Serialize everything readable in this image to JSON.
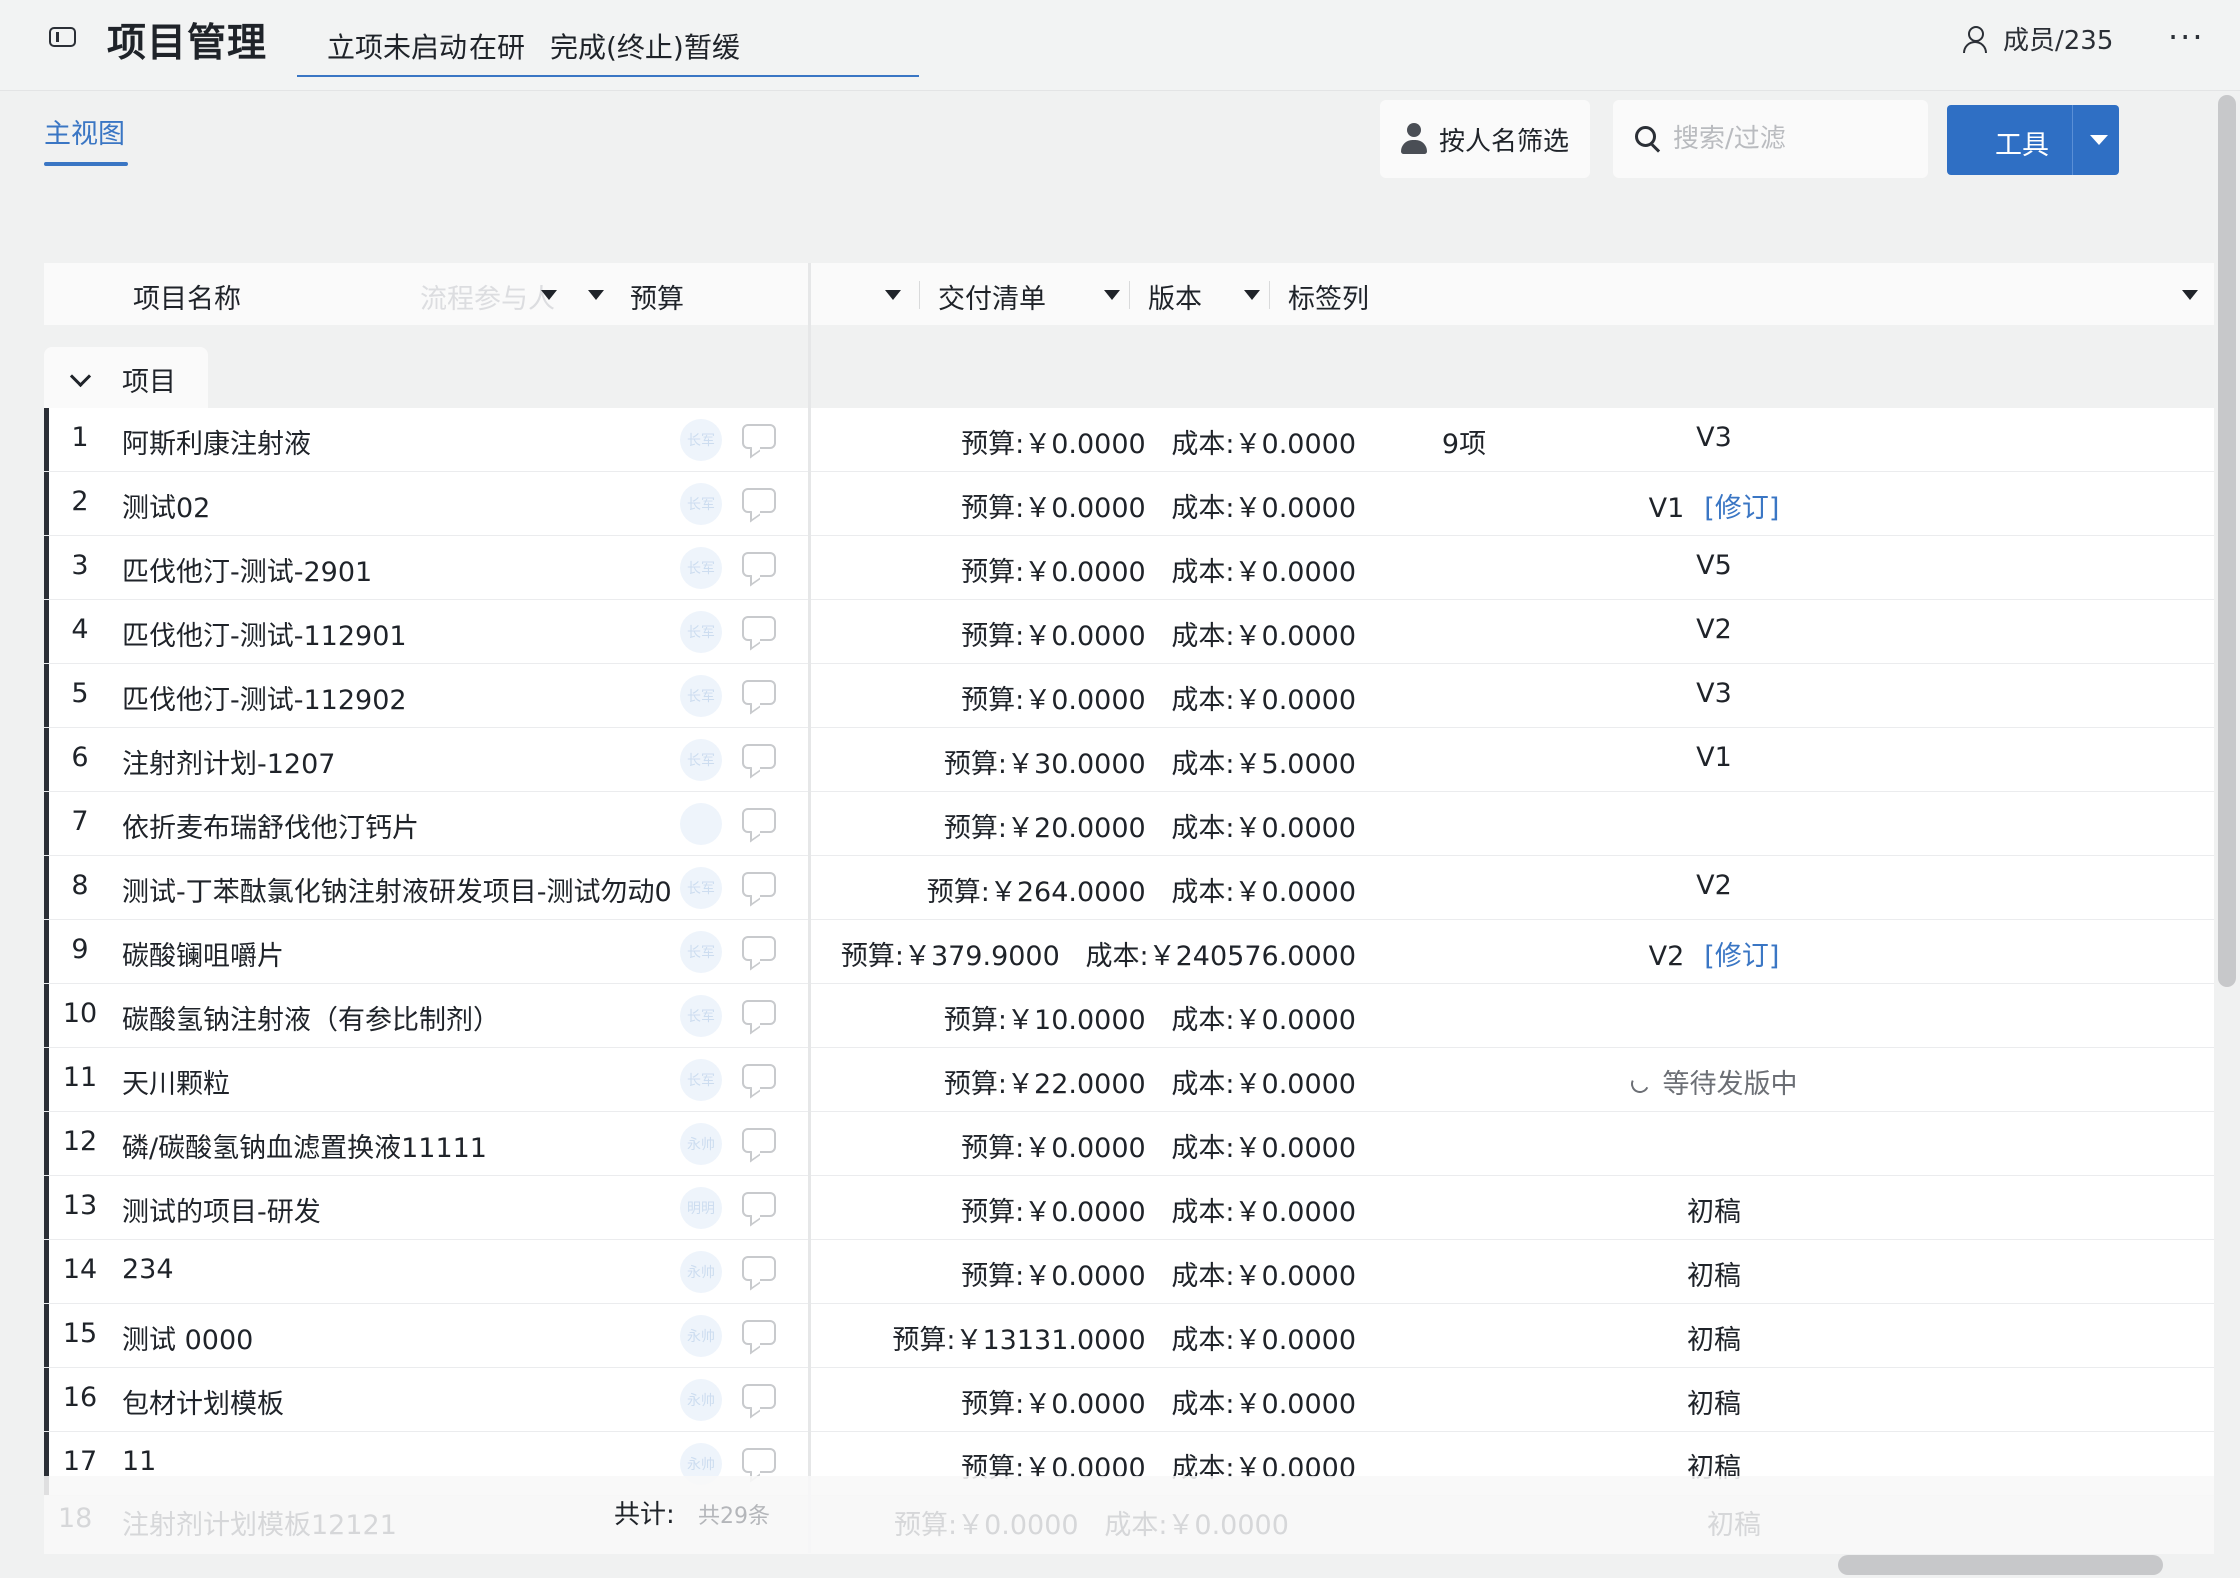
{
  "app": {
    "title": "项目管理"
  },
  "tabs": [
    "立项未启动",
    "在研",
    "完成(终止)",
    "暂缓"
  ],
  "members": {
    "label": "成员/235"
  },
  "more_label": "···",
  "view": {
    "tab": "主视图"
  },
  "toolbar": {
    "filter_by_person": "按人名筛选",
    "search_placeholder": "搜索/过滤",
    "tools_label": "工具"
  },
  "columns": {
    "name": "项目名称",
    "participants": "流程参与人",
    "budget": "预算",
    "delivery": "交付清单",
    "version": "版本",
    "tags": "标签列"
  },
  "group": {
    "label": "项目"
  },
  "rows": [
    {
      "num": "1",
      "name": "阿斯利康注射液",
      "avatar": "长军",
      "budget": "预算:￥0.0000   成本:￥0.0000",
      "delivery": "9项",
      "version": "V3",
      "revise": ""
    },
    {
      "num": "2",
      "name": "测试02",
      "avatar": "长军",
      "budget": "预算:￥0.0000   成本:￥0.0000",
      "delivery": "",
      "version": "V1",
      "revise": "[修订]"
    },
    {
      "num": "3",
      "name": "匹伐他汀-测试-2901",
      "avatar": "长军",
      "budget": "预算:￥0.0000   成本:￥0.0000",
      "delivery": "",
      "version": "V5",
      "revise": ""
    },
    {
      "num": "4",
      "name": "匹伐他汀-测试-112901",
      "avatar": "长军",
      "budget": "预算:￥0.0000   成本:￥0.0000",
      "delivery": "",
      "version": "V2",
      "revise": ""
    },
    {
      "num": "5",
      "name": "匹伐他汀-测试-112902",
      "avatar": "长军",
      "budget": "预算:￥0.0000   成本:￥0.0000",
      "delivery": "",
      "version": "V3",
      "revise": ""
    },
    {
      "num": "6",
      "name": "注射剂计划-1207",
      "avatar": "长军",
      "budget": "预算:￥30.0000   成本:￥5.0000",
      "delivery": "",
      "version": "V1",
      "revise": ""
    },
    {
      "num": "7",
      "name": "依折麦布瑞舒伐他汀钙片",
      "avatar": "",
      "budget": "预算:￥20.0000   成本:￥0.0000",
      "delivery": "",
      "version": "",
      "revise": ""
    },
    {
      "num": "8",
      "name": "测试-丁苯酞氯化钠注射液研发项目-测试勿动0",
      "avatar": "长军",
      "budget": "预算:￥264.0000   成本:￥0.0000",
      "delivery": "",
      "version": "V2",
      "revise": ""
    },
    {
      "num": "9",
      "name": "碳酸镧咀嚼片",
      "avatar": "长军",
      "budget": "预算:￥379.9000   成本:￥240576.0000",
      "delivery": "",
      "version": "V2",
      "revise": "[修订]"
    },
    {
      "num": "10",
      "name": "碳酸氢钠注射液（有参比制剂）",
      "avatar": "长军",
      "budget": "预算:￥10.0000   成本:￥0.0000",
      "delivery": "",
      "version": "",
      "revise": ""
    },
    {
      "num": "11",
      "name": "天川颗粒",
      "avatar": "长军",
      "budget": "预算:￥22.0000   成本:￥0.0000",
      "delivery": "",
      "version": "",
      "revise": "",
      "pending": "等待发版中"
    },
    {
      "num": "12",
      "name": "磷/碳酸氢钠血滤置换液11111",
      "avatar": "永帅",
      "budget": "预算:￥0.0000   成本:￥0.0000",
      "delivery": "",
      "version": "",
      "revise": ""
    },
    {
      "num": "13",
      "name": "测试的项目-研发",
      "avatar": "明明",
      "budget": "预算:￥0.0000   成本:￥0.0000",
      "delivery": "",
      "version": "初稿",
      "revise": ""
    },
    {
      "num": "14",
      "name": "234",
      "avatar": "永帅",
      "budget": "预算:￥0.0000   成本:￥0.0000",
      "delivery": "",
      "version": "初稿",
      "revise": ""
    },
    {
      "num": "15",
      "name": "测试 0000",
      "avatar": "永帅",
      "budget": "预算:￥13131.0000   成本:￥0.0000",
      "delivery": "",
      "version": "初稿",
      "revise": ""
    },
    {
      "num": "16",
      "name": "包材计划模板",
      "avatar": "永帅",
      "budget": "预算:￥0.0000   成本:￥0.0000",
      "delivery": "",
      "version": "初稿",
      "revise": ""
    },
    {
      "num": "17",
      "name": "11",
      "avatar": "永帅",
      "budget": "预算:￥0.0000   成本:￥0.0000",
      "delivery": "",
      "version": "初稿",
      "revise": ""
    }
  ],
  "footer": {
    "total_label": "共计:",
    "total_value": "共29条",
    "ghost_row": {
      "num": "18",
      "name": "注射剂计划模板12121",
      "budget": "预算:￥0.0000   成本:￥0.0000",
      "version": "初稿"
    }
  }
}
